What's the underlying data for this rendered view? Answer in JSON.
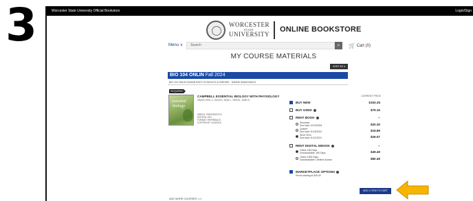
{
  "step_number": "3",
  "topbar": {
    "site_label": "Worcester State University Official Bookstore",
    "login_label": "Login/Sign"
  },
  "header": {
    "university_name_line1": "WORCESTER",
    "university_name_state": "STATE",
    "university_name_line2": "UNIVERSITY",
    "store_name": "ONLINE BOOKSTORE"
  },
  "nav": {
    "menu_label": "Menu ∨",
    "search_placeholder": "Search",
    "cart_label": "Cart (0)"
  },
  "page_title": "MY COURSE MATERIALS",
  "sort_label": "SORT BY ▾",
  "course": {
    "code": "BIO 104 ONLIN",
    "term": "Fall 2024",
    "subtitle": "BIO 104 ONLIN HUMAN BODY IN HEALTH & DISEASE · DANNE SIMAKOWICZ"
  },
  "required_tag": "REQUIRED",
  "book": {
    "cover_line1": "essential",
    "cover_line2": "biology",
    "title": "CAMPBELL ESSENTIAL BIOLOGY WITH PHYSIOLOGY",
    "author": "SIMON, ERIC J.; DICKEY, JEAN L.; REECE, JANE B.",
    "isbn": "ISBN13: 9780135337472",
    "edition": "EDITION: 6TH",
    "format": "FORMAT: PAPERBACK",
    "copyright": "COPYRIGHT: 2/18/2018"
  },
  "price_header": "CURRENT PRICE",
  "options": {
    "buy_new": {
      "label": "BUY NEW",
      "price": "$193.35",
      "checked": true
    },
    "buy_used": {
      "label": "BUY USED",
      "price": "$79.15",
      "checked": false
    },
    "rent_book": {
      "label": "RENT BOOK",
      "price": "--",
      "checked": false
    },
    "rent_semester": {
      "label": "Semester",
      "due": "Due back 12/13/2024",
      "price": "$20.30"
    },
    "rent_quarter": {
      "label": "Quarter",
      "due": "Due back 11/15/2024",
      "price": "$19.89"
    },
    "rent_short": {
      "label": "Short Term",
      "due": "Due back 11/11/2024",
      "price": "$26.57"
    },
    "rent_digital": {
      "label": "RENT DIGITAL EBOOK",
      "price": "--",
      "checked": false
    },
    "digital_180": {
      "label": "Online 180 Days",
      "note": "Downloadable: 180 Days",
      "price": "$49.49"
    },
    "digital_1825": {
      "label": "Online 1825 Days",
      "note": "Downloadable: Lifetime Access",
      "price": "$80.49"
    },
    "marketplace": {
      "label": "MARKETPLACE OPTIONS",
      "note": "Prices starting at $49.49",
      "checked": true
    }
  },
  "add_button_label": "ADD 1 ITEM TO CART",
  "more_courses_label": "ADD MORE COURSES >>>",
  "colors": {
    "course_header": "#1a4aa3",
    "arrow": "#f7b500",
    "topbar": "#000000"
  }
}
